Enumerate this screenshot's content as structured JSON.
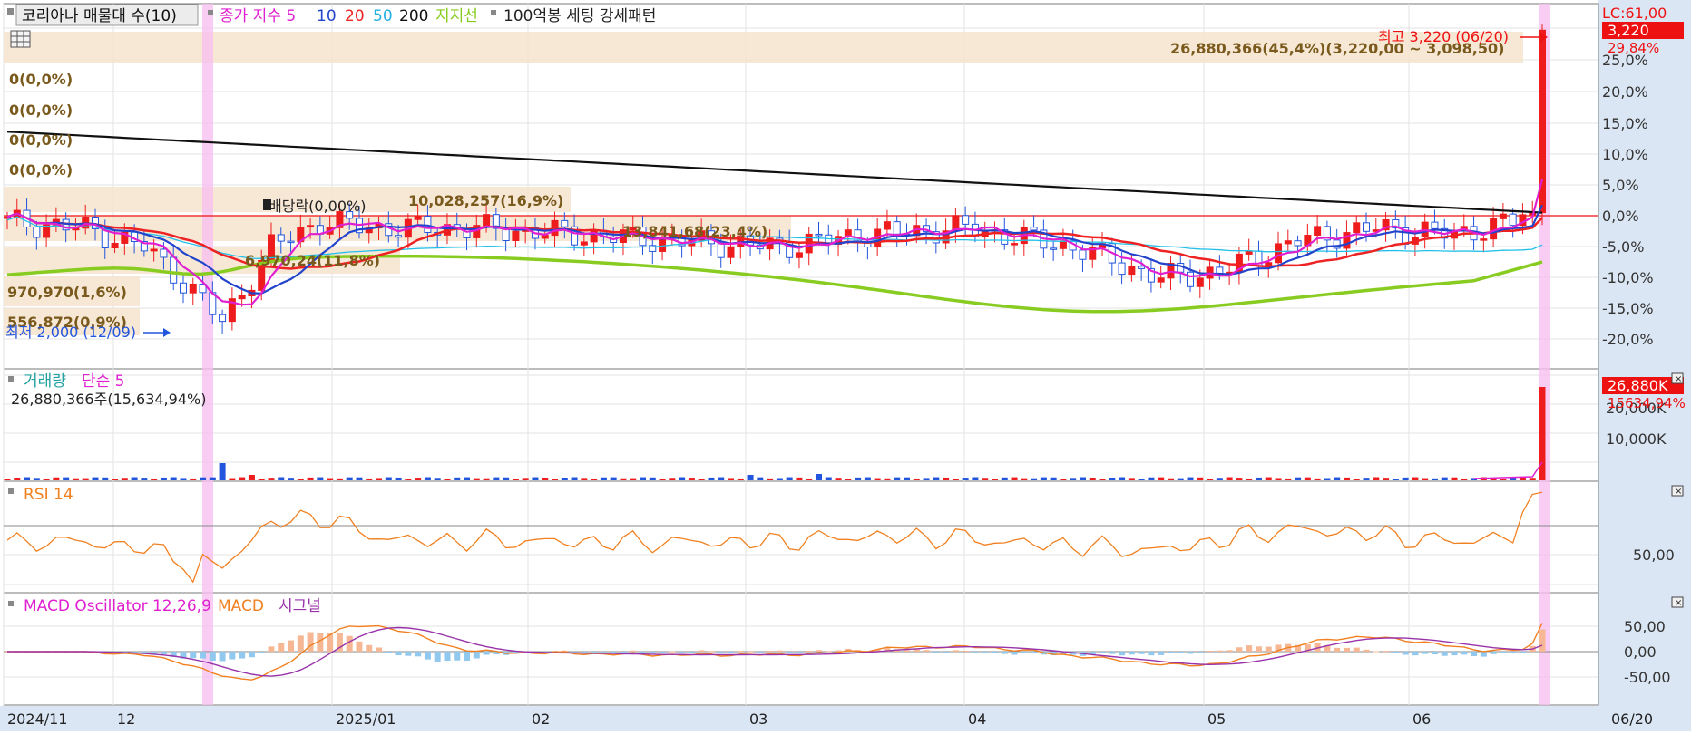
{
  "colors": {
    "up": "#ee1c1c",
    "down": "#2255dd",
    "ma5": "#e020d0",
    "ma10": "#2244cc",
    "ma20": "#ee2222",
    "ma50": "#22c0e8",
    "ma200": "#111111",
    "support": "#88cc22",
    "rsi": "#f08020",
    "macd": "#f08020",
    "signal": "#9933aa",
    "oscPos": "#f6b894",
    "oscNeg": "#90c8ee",
    "highlight": "#f8bff0",
    "band": "#f6e4cf",
    "bandText": "#7a5a1c",
    "axisBg": "#dbe6f4",
    "refLine": "#ee1111"
  },
  "panels": {
    "price": {
      "legend": {
        "title": "코리아나 매물대 수(10)",
        "close_ma_prefix": "종가 지수 5",
        "ma10": "10",
        "ma20": "20",
        "ma50": "50",
        "ma200": "200",
        "support": "지지선",
        "extra": "100억봉 세팅 강세패턴"
      },
      "lc": "LC:61,00",
      "price_badge": "3,220",
      "pct_badge": "29,84%",
      "high_label": "최고 3,220 (06/20)",
      "low_label": "최저 2,000 (12/09)",
      "dividend_label": "배당락(0,00%)",
      "left_labels": [
        "0(0,0%)",
        "0(0,0%)",
        "0(0,0%)",
        "0(0,0%)"
      ],
      "vp_labels": [
        "26,880,366(45,4%)(3,220,00 ~ 3,098,50)",
        "10,028,257(16,9%)",
        "13,841,68(23,4%)",
        "6,970,24(11,8%)",
        "970,970(1,6%)",
        "556,872(0,9%)"
      ],
      "axis_ticks": [
        "25,0%",
        "20,0%",
        "15,0%",
        "10,0%",
        "5,0%",
        "0,0%",
        "-5,0%",
        "-10,0%",
        "-15,0%",
        "-20,0%"
      ]
    },
    "volume": {
      "legend_title": "거래량",
      "legend_ma": "단순 5",
      "info": "26,880,366주(15,634,94%)",
      "badge": "26,880K",
      "badge2": "15634,94%",
      "axis_ticks": [
        "20,000K",
        "10,000K"
      ]
    },
    "rsi": {
      "legend": "RSI 14",
      "axis_ticks": [
        "50,00"
      ]
    },
    "macd": {
      "legend_osc": "MACD Oscillator 12,26,9",
      "legend_macd": "MACD",
      "legend_signal": "시그널",
      "axis_ticks": [
        "50,00",
        "0,00",
        "-50,00"
      ]
    }
  },
  "x_axis": {
    "labels": [
      "2024/11",
      "12",
      "2025/01",
      "02",
      "03",
      "04",
      "05",
      "06"
    ],
    "current": "06/20"
  },
  "chart_data": {
    "type": "candlestick",
    "title": "코리아나",
    "period": {
      "start": "2024/11",
      "end": "06/20"
    },
    "price": {
      "high": 3220,
      "high_date": "06/20",
      "low": 2000,
      "low_date": "12/09",
      "last_close": 3220,
      "last_change_pct": 29.84
    },
    "price_axis_percent_range": [
      -22,
      28
    ],
    "volume_profile": [
      {
        "volume": 26880366,
        "pct": 45.4,
        "range": [
          3098.5,
          3220.0
        ]
      },
      {
        "volume": 10028257,
        "pct": 16.9
      },
      {
        "volume": 13841680,
        "pct": 23.4
      },
      {
        "volume": 6970240,
        "pct": 11.8
      },
      {
        "volume": 970970,
        "pct": 1.6
      },
      {
        "volume": 556872,
        "pct": 0.9
      }
    ],
    "last_volume": 26880366,
    "last_volume_vs_ma_pct": 15634.94,
    "rsi": {
      "period": 14,
      "ylim": [
        0,
        100
      ]
    },
    "macd": {
      "params": [
        12,
        26,
        9
      ],
      "ylim": [
        -80,
        80
      ]
    }
  }
}
